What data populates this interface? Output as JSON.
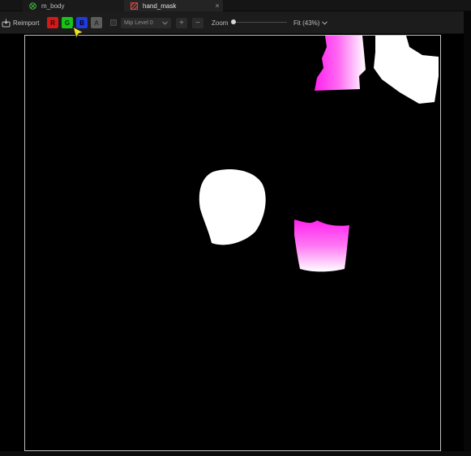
{
  "tabs": [
    {
      "label": "m_body",
      "icon": "material-icon"
    },
    {
      "label": "hand_mask",
      "icon": "texture-icon",
      "close": "×"
    }
  ],
  "toolbar": {
    "reimport_label": "Reimport",
    "channels": {
      "r": "R",
      "g": "G",
      "b": "B",
      "a": "A"
    },
    "mip_level": "Mip Level 0",
    "zoom_in": "+",
    "zoom_out": "−",
    "zoom_label": "Zoom",
    "zoom_slider_value": 0,
    "fit_label": "Fit (43%)"
  },
  "colors": {
    "accent_magenta": "#ff33ee",
    "channel_r": "#d21a1a",
    "channel_g": "#18c418",
    "channel_b": "#1f3bdb",
    "channel_a": "#5c5c5c",
    "cursor": "#f5e31a"
  }
}
